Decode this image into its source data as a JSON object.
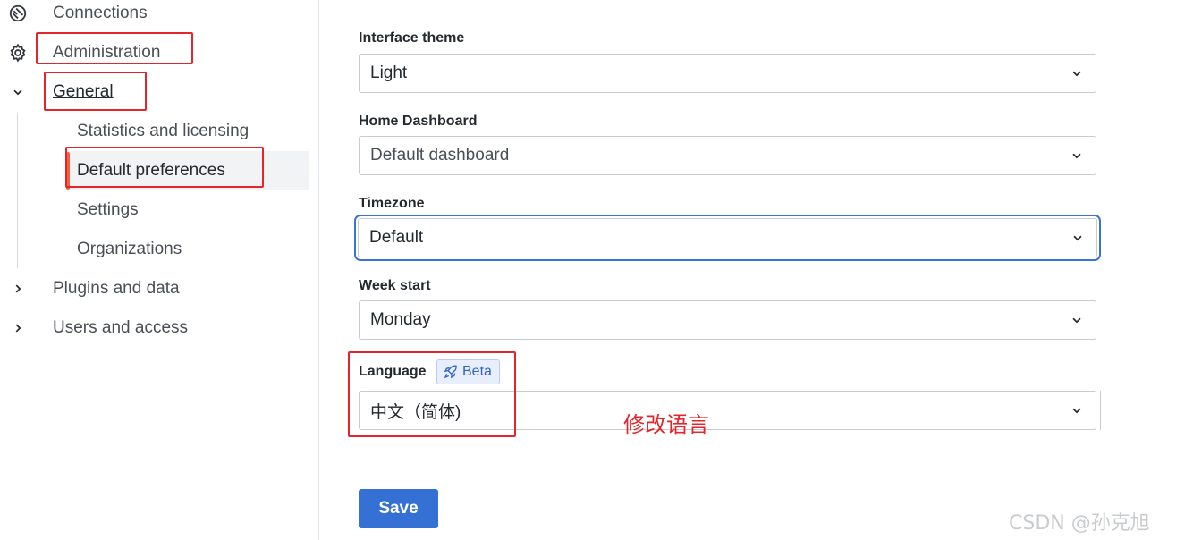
{
  "sidebar": {
    "connections": "Connections",
    "administration": "Administration",
    "general": "General",
    "sub_items": [
      "Statistics and licensing",
      "Default preferences",
      "Settings",
      "Organizations"
    ],
    "plugins": "Plugins and data",
    "users": "Users and access"
  },
  "form": {
    "theme": {
      "label": "Interface theme",
      "value": "Light"
    },
    "home": {
      "label": "Home Dashboard",
      "value": "Default dashboard"
    },
    "timezone": {
      "label": "Timezone",
      "value": "Default"
    },
    "week": {
      "label": "Week start",
      "value": "Monday"
    },
    "language": {
      "label": "Language",
      "badge": "Beta",
      "value": "中文（简体)"
    },
    "save_label": "Save"
  },
  "annotation": {
    "note": "修改语言"
  },
  "watermark": "CSDN @孙克旭",
  "colors": {
    "accent": "#3570d4",
    "annotation": "#e3262b",
    "active_bar": "#f55f3e",
    "focus": "#3c72d6"
  }
}
